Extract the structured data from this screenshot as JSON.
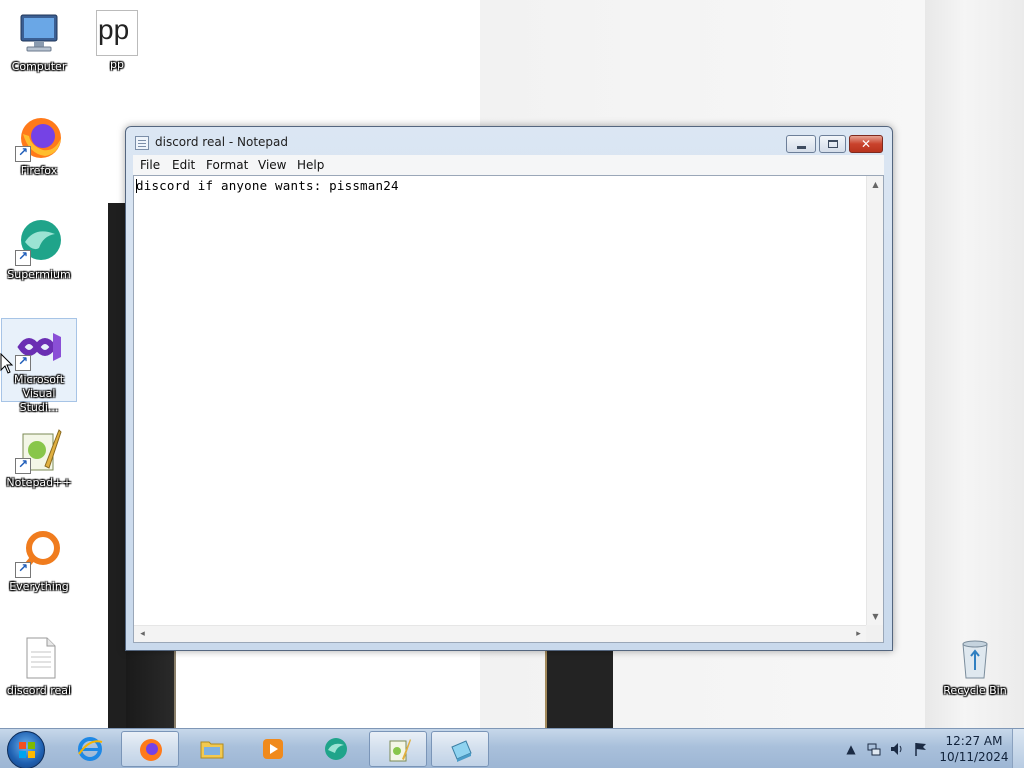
{
  "desktop": {
    "icons": [
      {
        "label": "Computer"
      },
      {
        "label": "pp",
        "glyph": "pp"
      },
      {
        "label": "Firefox"
      },
      {
        "label": "Supermium"
      },
      {
        "label": "Microsoft Visual Studi..."
      },
      {
        "label": "Notepad++"
      },
      {
        "label": "Everything"
      },
      {
        "label": "discord real"
      },
      {
        "label": "Recycle Bin"
      }
    ]
  },
  "notepad": {
    "title": "discord real - Notepad",
    "menu": [
      "File",
      "Edit",
      "Format",
      "View",
      "Help"
    ],
    "content": "discord if anyone wants: pissman24",
    "close_glyph": "✕"
  },
  "taskbar": {
    "items": [
      {
        "name": "Internet Explorer"
      },
      {
        "name": "Firefox",
        "active": true
      },
      {
        "name": "File Explorer"
      },
      {
        "name": "Media Player"
      },
      {
        "name": "Supermium"
      },
      {
        "name": "Notepad++",
        "active": true
      },
      {
        "name": "Notepad",
        "active": true
      }
    ],
    "tray_icons": [
      "chevron-up-icon",
      "network-icon",
      "volume-icon",
      "flag-icon"
    ],
    "time": "12:27 AM",
    "date": "10/11/2024"
  },
  "colors": {
    "taskbar": "#a9c0db",
    "close_button": "#c9422c",
    "window_frame": "#c9d9ec"
  }
}
